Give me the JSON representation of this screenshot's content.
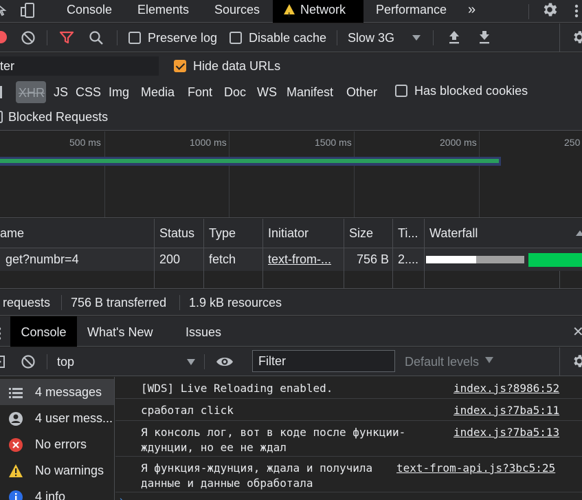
{
  "top_tabs": {
    "console": "Console",
    "elements": "Elements",
    "sources": "Sources",
    "network": "Network",
    "performance": "Performance",
    "more": "»"
  },
  "net_toolbar": {
    "preserve_log": "Preserve log",
    "disable_cache": "Disable cache",
    "throttle": "Slow 3G"
  },
  "filter": {
    "input_value": "ter",
    "hide_data_urls": "Hide data URLs",
    "types": [
      "XHR",
      "JS",
      "CSS",
      "Img",
      "Media",
      "Font",
      "Doc",
      "WS",
      "Manifest",
      "Other"
    ],
    "has_blocked_cookies": "Has blocked cookies",
    "blocked_requests": "Blocked Requests"
  },
  "overview": {
    "ticks": [
      "500 ms",
      "1000 ms",
      "1500 ms",
      "2000 ms",
      "250"
    ]
  },
  "table": {
    "headers": {
      "name": "ame",
      "status": "Status",
      "type": "Type",
      "initiator": "Initiator",
      "size": "Size",
      "time": "Ti...",
      "waterfall": "Waterfall"
    },
    "row": {
      "name": "get?numbr=4",
      "status": "200",
      "type": "fetch",
      "initiator": "text-from-...",
      "size": "756 B",
      "time": "2...."
    }
  },
  "summary": {
    "requests": "requests",
    "transferred": "756 B transferred",
    "resources": "1.9 kB resources"
  },
  "drawer_tabs": {
    "console": "Console",
    "whats_new": "What's New",
    "issues": "Issues",
    "close": "✕"
  },
  "console_toolbar": {
    "context": "top",
    "filter_placeholder": "Filter",
    "levels": "Default levels"
  },
  "sidebar": {
    "items": [
      {
        "label": "4 messages"
      },
      {
        "label": "4 user mess..."
      },
      {
        "label": "No errors"
      },
      {
        "label": "No warnings"
      },
      {
        "label": "4 info"
      }
    ]
  },
  "messages": [
    {
      "text": "[WDS] Live Reloading enabled.",
      "source": "index.js?8986:52"
    },
    {
      "text": "сработал click",
      "source": "index.js?7ba5:11"
    },
    {
      "text": "Я консоль лог, вот в коде после функции-\nждунции, но ее не ждал",
      "source": "index.js?7ba5:13"
    },
    {
      "text": "Я функция-ждунция, ждала и получила\nданные и данные обработала",
      "source": "text-from-api.js?3bc5:25"
    }
  ],
  "colors": {
    "accent_orange": "#f39c33",
    "filter_red": "#f2555a",
    "bar_green": "#00c853",
    "error_red": "#e0433b",
    "warning_yellow": "#f0c337",
    "info_blue": "#2b6ee8"
  }
}
